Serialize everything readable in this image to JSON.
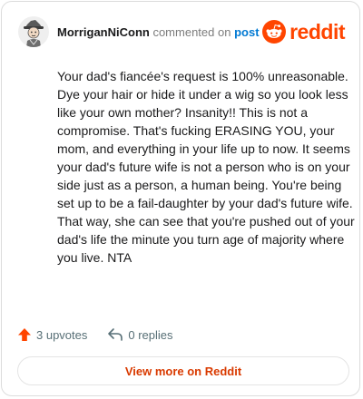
{
  "comment": {
    "username": "MorriganNiConn",
    "action_text": "commented on",
    "target_link": "post",
    "body": "Your dad's fiancée's request is 100% unreasonable. Dye your hair or hide it under a wig so you look less like your own mother? Insanity!! This is not a compromise. That's fucking ERASING YOU, your mom, and everything in your life up to now. It seems your dad's future wife is not a person who is on your side just as a person, a human being. You're being set up to be a fail-daughter by your dad's future wife. That way, she can see that you're pushed out of your dad's life the minute you turn age of majority where you live. NTA",
    "upvotes_label": "3 upvotes",
    "replies_label": "0 replies"
  },
  "brand": {
    "wordmark": "reddit",
    "icon": "reddit-snoo-icon",
    "color": "#ff4500"
  },
  "footer": {
    "view_more_label": "View more on Reddit"
  },
  "colors": {
    "username": "#1a1a1b",
    "muted": "#7c7c7c",
    "link": "#0079d3",
    "upvote": "#ff4500",
    "cta": "#d93a00"
  }
}
